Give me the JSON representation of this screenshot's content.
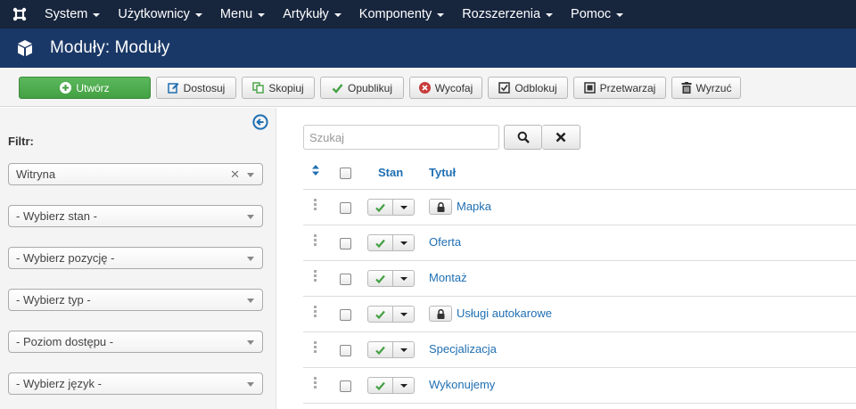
{
  "colors": {
    "nav_bg": "#17253d",
    "header_bg": "#1a3867",
    "link": "#1f6fb2",
    "success": "#43a043",
    "danger": "#c83b3b"
  },
  "nav": {
    "logo": "joomla-icon",
    "items": [
      {
        "label": "System"
      },
      {
        "label": "Użytkownicy"
      },
      {
        "label": "Menu"
      },
      {
        "label": "Artykuły"
      },
      {
        "label": "Komponenty"
      },
      {
        "label": "Rozszerzenia"
      },
      {
        "label": "Pomoc"
      }
    ]
  },
  "header": {
    "title": "Moduły: Moduły",
    "icon": "cube-icon"
  },
  "toolbar": {
    "new_label": "Utwórz",
    "edit_label": "Dostosuj",
    "copy_label": "Skopiuj",
    "publish_label": "Opublikuj",
    "unpublish_label": "Wycofaj",
    "checkin_label": "Odblokuj",
    "batch_label": "Przetwarzaj",
    "trash_label": "Wyrzuć"
  },
  "sidebar": {
    "filter_label": "Filtr:",
    "filters": [
      {
        "value": "Witryna",
        "clearable": true
      },
      {
        "value": "- Wybierz stan -"
      },
      {
        "value": "- Wybierz pozycję -"
      },
      {
        "value": "- Wybierz typ -"
      },
      {
        "value": "- Poziom dostępu -"
      },
      {
        "value": "- Wybierz język -"
      }
    ]
  },
  "search": {
    "placeholder": "Szukaj"
  },
  "table": {
    "headers": {
      "status": "Stan",
      "title": "Tytuł"
    },
    "rows": [
      {
        "title": "Mapka",
        "locked": true,
        "published": true
      },
      {
        "title": "Oferta",
        "locked": false,
        "published": true
      },
      {
        "title": "Montaż",
        "locked": false,
        "published": true
      },
      {
        "title": "Usługi autokarowe",
        "locked": true,
        "published": true
      },
      {
        "title": "Specjalizacja",
        "locked": false,
        "published": true
      },
      {
        "title": "Wykonujemy",
        "locked": false,
        "published": true
      }
    ]
  }
}
